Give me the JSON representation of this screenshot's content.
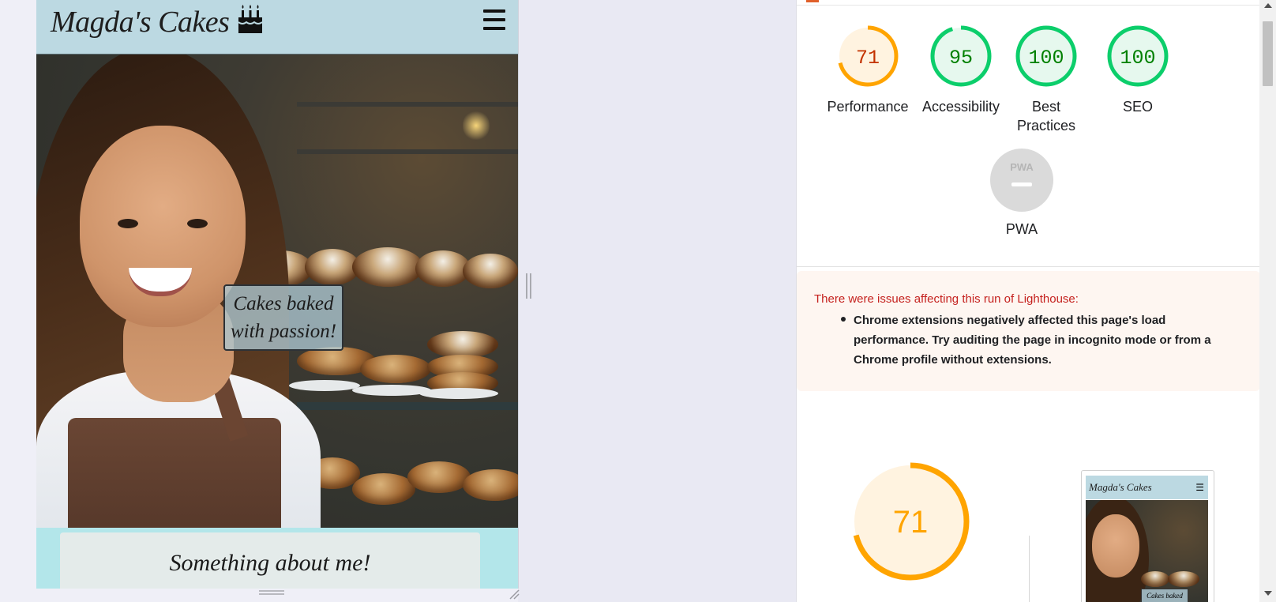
{
  "site": {
    "brand": "Magda's Cakes",
    "brand_icon": "birthday-cake-icon",
    "menu_icon": "hamburger-menu-icon",
    "hero_caption_line1": "Cakes baked",
    "hero_caption_line2": "with passion!",
    "about_title": "Something about me!"
  },
  "lighthouse": {
    "scores": [
      {
        "label": "Performance",
        "value": "71",
        "score": 71,
        "color": "#ffa400",
        "text_color": "#c33300",
        "bg": "#fff3e0"
      },
      {
        "label": "Accessibility",
        "value": "95",
        "score": 95,
        "color": "#0cce6b",
        "text_color": "#008000",
        "bg": "#e6f8ee"
      },
      {
        "label": "Best Practices",
        "value": "100",
        "score": 100,
        "color": "#0cce6b",
        "text_color": "#008000",
        "bg": "#e6f8ee"
      },
      {
        "label": "SEO",
        "value": "100",
        "score": 100,
        "color": "#0cce6b",
        "text_color": "#008000",
        "bg": "#e6f8ee"
      }
    ],
    "pwa": {
      "label": "PWA",
      "badge_text": "PWA",
      "badge_icon": "pwa-badge-icon"
    },
    "warning": {
      "title": "There were issues affecting this run of Lighthouse:",
      "items": [
        "Chrome extensions negatively affected this page's load performance. Try auditing the page in incognito mode or from a Chrome profile without extensions."
      ]
    },
    "main_score": {
      "value": "71",
      "score": 71,
      "color": "#ffa400",
      "bg": "#fff3e0"
    },
    "thumbnail": {
      "brand": "Magda's Cakes",
      "caption": "Cakes baked"
    }
  }
}
